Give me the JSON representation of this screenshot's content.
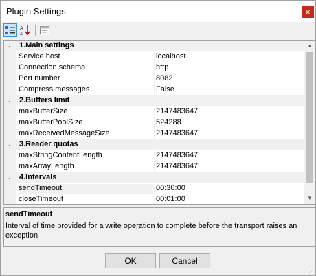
{
  "window": {
    "title": "Plugin Settings",
    "close_glyph": "×"
  },
  "toolbar": [
    {
      "name": "categorized-icon",
      "active": true
    },
    {
      "name": "alphabetical-icon",
      "glyph": "A↓Z",
      "active": false
    },
    {
      "name": "property-pages-icon",
      "active": false
    }
  ],
  "grid": {
    "rows": [
      {
        "type": "category",
        "label": "1.Main settings"
      },
      {
        "type": "property",
        "name": "Service host",
        "value": "localhost"
      },
      {
        "type": "property",
        "name": "Connection schema",
        "value": "http"
      },
      {
        "type": "property",
        "name": "Port number",
        "value": "8082"
      },
      {
        "type": "property",
        "name": "Compress messages",
        "value": "False"
      },
      {
        "type": "category",
        "label": "2.Buffers limit"
      },
      {
        "type": "property",
        "name": "maxBufferSize",
        "value": "2147483647"
      },
      {
        "type": "property",
        "name": "maxBufferPoolSize",
        "value": "524288"
      },
      {
        "type": "property",
        "name": "maxReceivedMessageSize",
        "value": "2147483647"
      },
      {
        "type": "category",
        "label": "3.Reader quotas"
      },
      {
        "type": "property",
        "name": "maxStringContentLength",
        "value": "2147483647"
      },
      {
        "type": "property",
        "name": "maxArrayLength",
        "value": "2147483647"
      },
      {
        "type": "category",
        "label": "4.Intervals"
      },
      {
        "type": "property",
        "name": "sendTimeout",
        "value": "00:30:00",
        "selected": true
      },
      {
        "type": "property",
        "name": "closeTimeout",
        "value": "00:01:00"
      }
    ],
    "toggle_glyph": "⌄"
  },
  "help": {
    "title": "sendTimeout",
    "description": "Interval of time provided for a write operation to complete before the transport raises an exception"
  },
  "buttons": {
    "ok": "OK",
    "cancel": "Cancel"
  }
}
